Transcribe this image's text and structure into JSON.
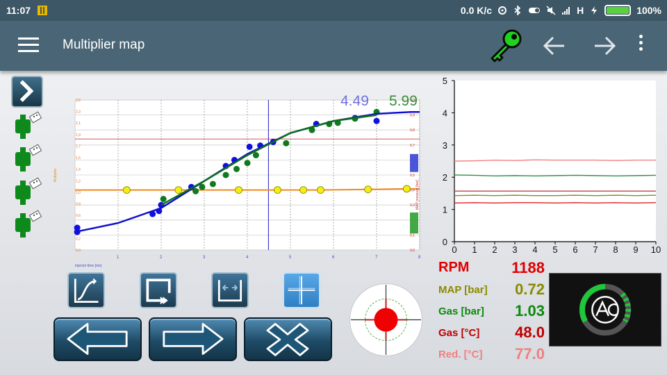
{
  "status_bar": {
    "time": "11:07",
    "net_speed": "0.0 K/c",
    "network_type": "H",
    "battery": "100%"
  },
  "app_bar": {
    "title": "Multiplier map"
  },
  "chart_data": [
    {
      "type": "line",
      "xlabel": "Injector time [ms]",
      "ylabel": "Multiplier",
      "y2label": "MAP pressure [bar]",
      "xlim": [
        0,
        8
      ],
      "ylim": [
        0,
        2.5
      ],
      "x_ticks": [
        "1",
        "2",
        "3",
        "4",
        "5",
        "6",
        "7",
        "8"
      ],
      "y_ticks": [
        "0,0",
        "0,2",
        "0,4",
        "0,6",
        "0,8",
        "1,0",
        "1,2",
        "1,4",
        "1,5",
        "1,7",
        "1,9",
        "2,1",
        "2,3",
        "2,5"
      ],
      "y2_ticks": [
        "0,0",
        "0,1",
        "0,2",
        "0,3",
        "0,4",
        "0,5",
        "0,6",
        "0,7",
        "0,8",
        "0,9",
        "1,0"
      ],
      "readouts": [
        "4.49",
        "5.99"
      ],
      "cursor_x": 4.49,
      "reference_line_y": 1.85,
      "multiplier_points": [
        {
          "x": 1.2,
          "y": 1.0
        },
        {
          "x": 2.4,
          "y": 1.0
        },
        {
          "x": 3.8,
          "y": 1.0
        },
        {
          "x": 4.7,
          "y": 1.0
        },
        {
          "x": 5.3,
          "y": 1.0
        },
        {
          "x": 5.7,
          "y": 1.0
        },
        {
          "x": 6.8,
          "y": 1.01
        },
        {
          "x": 7.7,
          "y": 1.02
        }
      ],
      "fit_curves": [
        {
          "color": "#1010cc",
          "points": [
            [
              0.0,
              0.3
            ],
            [
              1.0,
              0.45
            ],
            [
              2.0,
              0.7
            ],
            [
              3.0,
              1.15
            ],
            [
              4.0,
              1.6
            ],
            [
              5.0,
              1.95
            ],
            [
              6.0,
              2.15
            ],
            [
              7.0,
              2.27
            ],
            [
              7.8,
              2.3
            ],
            [
              8.0,
              2.3
            ]
          ]
        },
        {
          "color": "#0d6e1c",
          "points": [
            [
              2.0,
              0.75
            ],
            [
              3.0,
              1.15
            ],
            [
              4.0,
              1.58
            ],
            [
              5.0,
              1.95
            ],
            [
              6.0,
              2.15
            ],
            [
              7.0,
              2.25
            ]
          ]
        }
      ],
      "scatter_blue": [
        [
          0.05,
          0.37
        ],
        [
          0.05,
          0.3
        ],
        [
          1.8,
          0.6
        ],
        [
          1.95,
          0.65
        ],
        [
          2.0,
          0.75
        ],
        [
          2.7,
          1.05
        ],
        [
          3.5,
          1.4
        ],
        [
          3.7,
          1.5
        ],
        [
          4.05,
          1.72
        ],
        [
          4.3,
          1.74
        ],
        [
          4.6,
          1.8
        ],
        [
          5.6,
          2.1
        ],
        [
          6.5,
          2.2
        ],
        [
          7.0,
          2.15
        ]
      ],
      "scatter_green": [
        [
          2.05,
          0.85
        ],
        [
          2.8,
          0.98
        ],
        [
          2.95,
          1.05
        ],
        [
          3.2,
          1.1
        ],
        [
          3.5,
          1.25
        ],
        [
          3.75,
          1.35
        ],
        [
          4.0,
          1.45
        ],
        [
          4.2,
          1.58
        ],
        [
          4.9,
          1.78
        ],
        [
          5.5,
          2.0
        ],
        [
          5.9,
          2.1
        ],
        [
          6.1,
          2.12
        ],
        [
          6.5,
          2.19
        ],
        [
          7.0,
          2.3
        ]
      ],
      "pressure_bars": [
        {
          "color": "#4a55d8",
          "y_from": 0.52,
          "y_to": 0.64
        },
        {
          "color": "#44a845",
          "y_from": 0.11,
          "y_to": 0.25
        }
      ]
    },
    {
      "type": "line",
      "xlim": [
        0,
        10
      ],
      "ylim": [
        0,
        5
      ],
      "x_ticks": [
        "0",
        "1",
        "2",
        "3",
        "4",
        "5",
        "6",
        "7",
        "8",
        "9",
        "10"
      ],
      "y_ticks": [
        "0",
        "1",
        "2",
        "3",
        "4",
        "5"
      ],
      "series": [
        {
          "color": "#f08080",
          "values": [
            2.5,
            2.51,
            2.53,
            2.52,
            2.54,
            2.53,
            2.53,
            2.53,
            2.52,
            2.53,
            2.53
          ]
        },
        {
          "color": "#2f8f3f",
          "values": [
            2.07,
            2.06,
            2.04,
            2.05,
            2.04,
            2.05,
            2.06,
            2.05,
            2.04,
            2.05,
            2.06
          ]
        },
        {
          "color": "#c0404a",
          "values": [
            1.57,
            1.57,
            1.57,
            1.57,
            1.57,
            1.57,
            1.57,
            1.57,
            1.57,
            1.57,
            1.57
          ]
        },
        {
          "color": "#808a20",
          "values": [
            1.43,
            1.44,
            1.43,
            1.44,
            1.43,
            1.43,
            1.44,
            1.43,
            1.44,
            1.43,
            1.44
          ]
        },
        {
          "color": "#e02020",
          "values": [
            1.2,
            1.21,
            1.2,
            1.21,
            1.21,
            1.2,
            1.21,
            1.2,
            1.21,
            1.2,
            1.21
          ]
        }
      ]
    }
  ],
  "readouts": [
    {
      "label": "RPM",
      "value": "1188",
      "label_color": "#e00000",
      "value_color": "#e00000"
    },
    {
      "label": "MAP [bar]",
      "value": "0.72",
      "label_color": "#8a8a00",
      "value_color": "#8a8a00"
    },
    {
      "label": "Gas [bar]",
      "value": "1.03",
      "label_color": "#0a8a0a",
      "value_color": "#0a8a0a"
    },
    {
      "label": "Gas [°C]",
      "value": "48.0",
      "label_color": "#c00000",
      "value_color": "#c00000"
    },
    {
      "label": "Red. [°C]",
      "value": "77.0",
      "label_color": "#f08080",
      "value_color": "#f08080"
    }
  ],
  "colors": {
    "status_bar": "#3d5766",
    "app_bar": "#4a6676",
    "key_icon": "#1fd21f",
    "accent_blue": "#2f7fc4"
  },
  "icons": {
    "menu": "hamburger-icon",
    "key": "key-icon",
    "back": "arrow-left-icon",
    "forward": "arrow-right-icon",
    "more": "more-vert-icon",
    "panel_toggle": "chevron-right-icon",
    "injector": "injector-icon",
    "tools": [
      "curve-icon",
      "rectangle-icon",
      "expand-icon",
      "crosshair-icon"
    ],
    "nav": [
      "big-arrow-left-icon",
      "big-arrow-right-icon",
      "close-x-icon"
    ],
    "target": "target-icon",
    "logo": "ac-logo-icon"
  }
}
